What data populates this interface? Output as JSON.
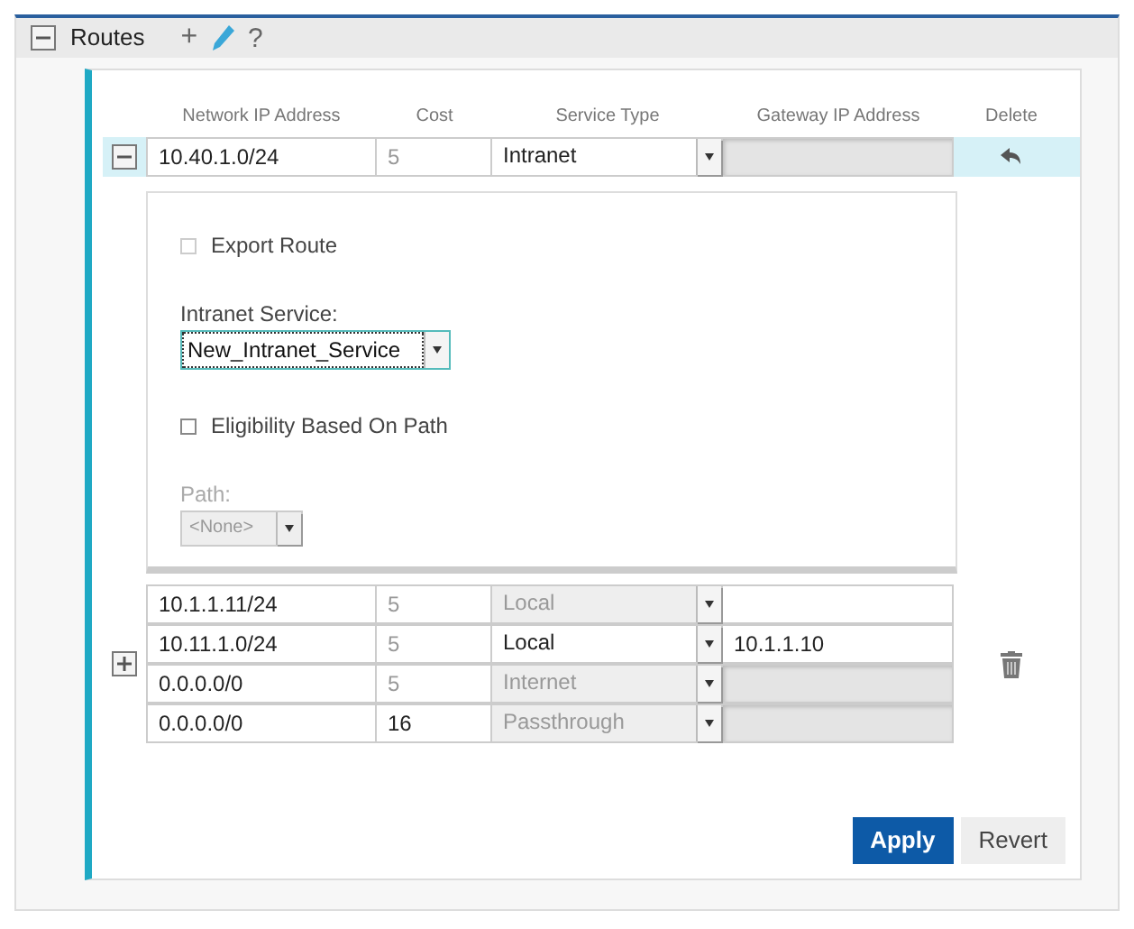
{
  "section": {
    "title": "Routes",
    "expanded": true,
    "actions": [
      "+",
      "?"
    ]
  },
  "columns": [
    "Network IP Address",
    "Cost",
    "Service Type",
    "Gateway IP Address",
    "Delete"
  ],
  "groups": [
    {
      "expanded": true,
      "selected": true,
      "kind": "undo",
      "rows": [
        {
          "network": "10.40.1.0/24",
          "cost": "5",
          "cost_dim": true,
          "service": "Intranet",
          "service_disabled": false,
          "gateway": "",
          "gateway_disabled": true
        }
      ],
      "details": {
        "export_route": {
          "label": "Export Route",
          "checked": false,
          "disabled": true
        },
        "intranet_service": {
          "label": "Intranet Service:",
          "value": "New_Intranet_Service"
        },
        "eligibility": {
          "label": "Eligibility Based On Path",
          "checked": false,
          "disabled": false
        },
        "path": {
          "label": "Path:",
          "value": "<None>",
          "disabled": true
        }
      }
    },
    {
      "expanded": false,
      "selected": false,
      "kind": "delete",
      "rows": [
        {
          "network": "10.1.1.11/24",
          "cost": "5",
          "cost_dim": true,
          "service": "Local",
          "service_disabled": true,
          "gateway": "",
          "gateway_disabled": false
        },
        {
          "network": "10.11.1.0/24",
          "cost": "5",
          "cost_dim": true,
          "service": "Local",
          "service_disabled": false,
          "gateway": "10.1.1.10",
          "gateway_disabled": false
        },
        {
          "network": "0.0.0.0/0",
          "cost": "5",
          "cost_dim": true,
          "service": "Internet",
          "service_disabled": true,
          "gateway": "",
          "gateway_disabled": true
        },
        {
          "network": "0.0.0.0/0",
          "cost": "16",
          "cost_dim": false,
          "service": "Passthrough",
          "service_disabled": true,
          "gateway": "",
          "gateway_disabled": true
        }
      ]
    }
  ],
  "buttons": [
    {
      "label": "Apply",
      "kind": "primary"
    },
    {
      "label": "Revert",
      "kind": "secondary"
    }
  ]
}
